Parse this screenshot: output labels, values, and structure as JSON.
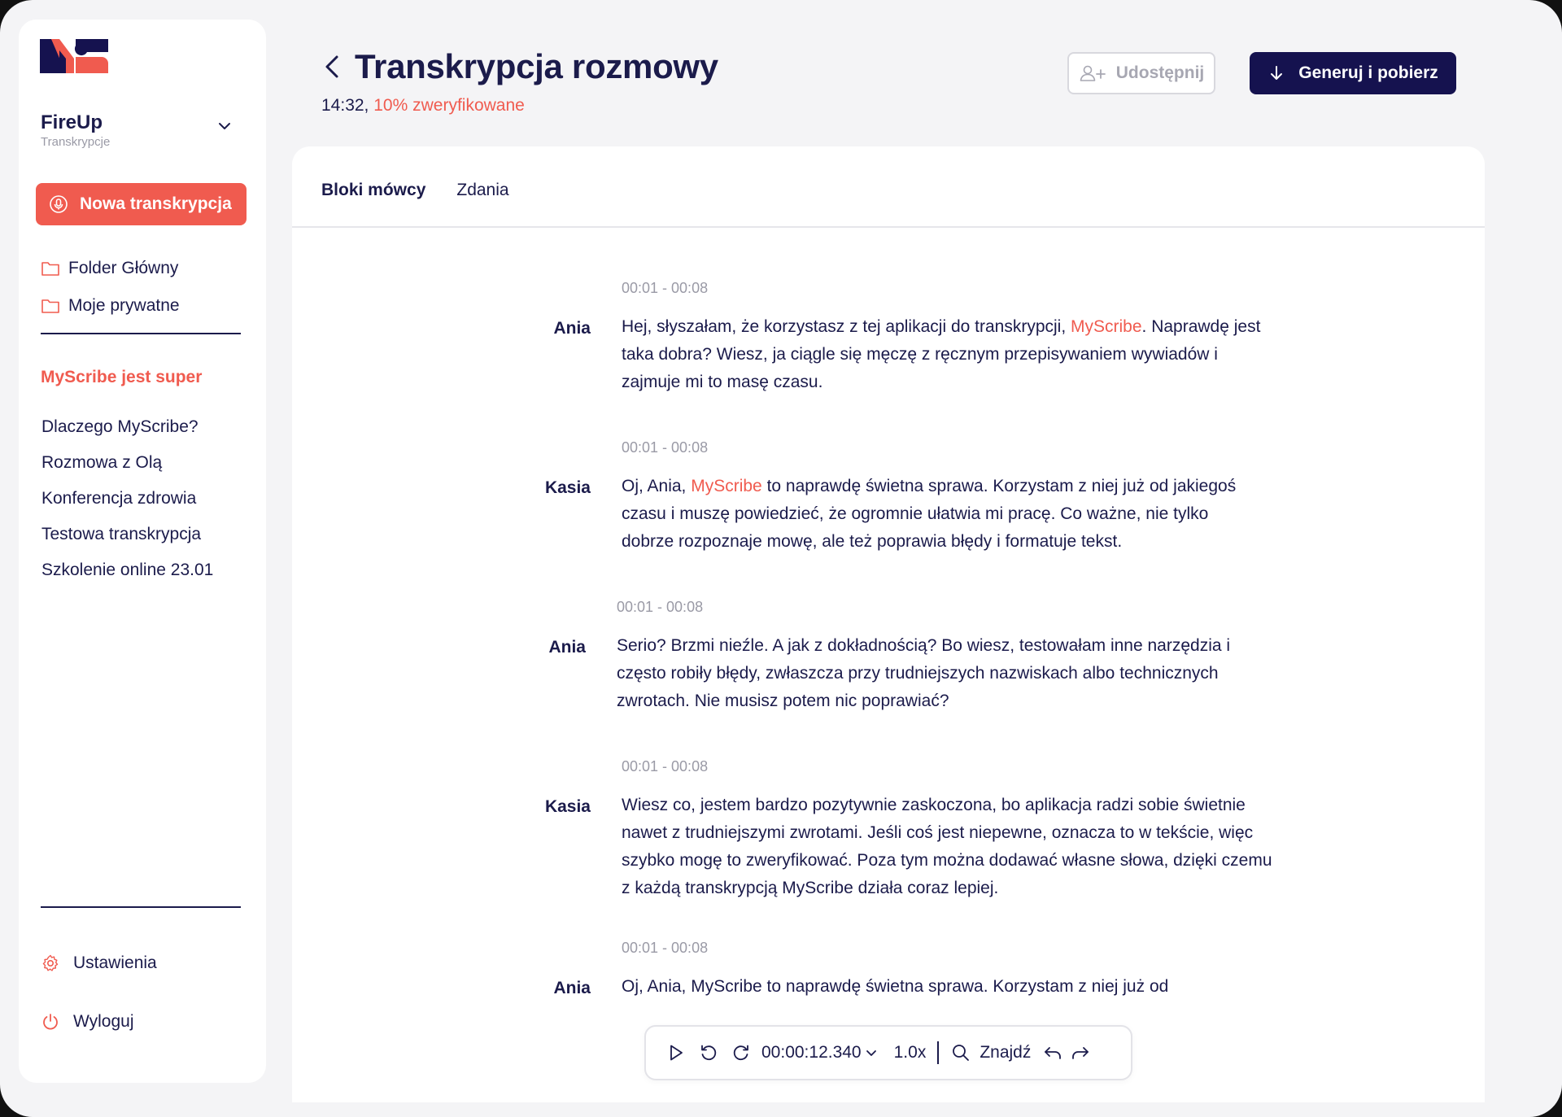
{
  "sidebar": {
    "org_name": "FireUp",
    "org_sub": "Transkrypcje",
    "new_button": "Nowa transkrypcja",
    "folders": [
      {
        "label": "Folder Główny",
        "icon": "folder-icon"
      },
      {
        "label": "Moje prywatne",
        "icon": "folder-icon"
      }
    ],
    "section_title": "MyScribe jest super",
    "documents": [
      "Dlaczego MyScribe?",
      "Rozmowa z Olą",
      "Konferencja zdrowia",
      "Testowa transkrypcja",
      "Szkolenie online 23.01"
    ],
    "settings_label": "Ustawienia",
    "logout_label": "Wyloguj"
  },
  "header": {
    "title": "Transkrypcja rozmowy",
    "duration": "14:32,",
    "verified": "10% zweryfikowane",
    "share_label": "Udostępnij",
    "generate_label": "Generuj i pobierz"
  },
  "tabs": [
    "Bloki mówcy",
    "Zdania"
  ],
  "blocks": [
    {
      "timestamp": "00:01 -  00:08",
      "speaker": "Ania",
      "text_before": "Hej, słyszałam, że korzystasz z tej aplikacji do transkrypcji, ",
      "highlight": "MyScribe",
      "text_after": ". Naprawdę jest taka dobra? Wiesz, ja ciągle się męczę z ręcznym przepisywaniem wywiadów i zajmuje mi to masę czasu."
    },
    {
      "timestamp": "00:01 -  00:08",
      "speaker": "Kasia",
      "text_before": "Oj, Ania, ",
      "highlight": "MyScribe",
      "text_after": " to naprawdę świetna sprawa. Korzystam z niej już od jakiegoś czasu i muszę powiedzieć, że ogromnie ułatwia mi pracę. Co ważne, nie tylko dobrze rozpoznaje mowę, ale też poprawia błędy i formatuje tekst."
    },
    {
      "timestamp": "00:01 -  00:08",
      "speaker": "Ania",
      "text_before": "Serio? Brzmi nieźle. A jak z dokładnością? Bo wiesz, testowałam inne narzędzia i często robiły błędy, zwłaszcza przy trudniejszych nazwiskach albo technicznych zwrotach. Nie musisz potem nic poprawiać?",
      "highlight": "",
      "text_after": ""
    },
    {
      "timestamp": "00:01 -  00:08",
      "speaker": "Kasia",
      "text_before": "Wiesz co, jestem bardzo pozytywnie zaskoczona, bo aplikacja radzi sobie świetnie nawet z trudniejszymi zwrotami. Jeśli coś jest niepewne, oznacza to w tekście, więc szybko mogę to zweryfikować. Poza tym można dodawać własne słowa, dzięki czemu z każdą transkrypcją MyScribe działa coraz lepiej.",
      "highlight": "",
      "text_after": ""
    },
    {
      "timestamp": "00:01 -  00:08",
      "speaker": "Ania",
      "text_before": "Oj, Ania, MyScribe to naprawdę świetna sprawa. Korzystam z niej już od",
      "highlight": "",
      "text_after": ""
    }
  ],
  "player": {
    "time": "00:00:12.340",
    "speed": "1.0x",
    "find_label": "Znajdź"
  },
  "colors": {
    "accent": "#f05b4f",
    "primary": "#15124f",
    "text": "#1b1b4b",
    "muted": "#9a9aa6"
  }
}
